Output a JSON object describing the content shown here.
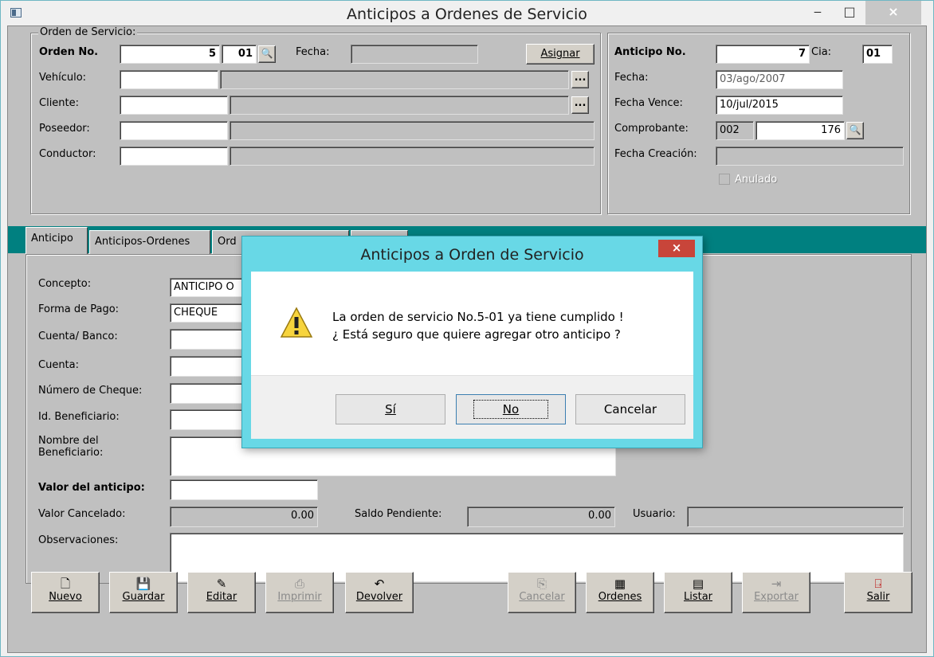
{
  "window": {
    "title": "Anticipos a Ordenes de Servicio",
    "min_glyph": "‒",
    "max_glyph": "□",
    "close_glyph": "×"
  },
  "orden": {
    "group_label": "Orden de Servicio:",
    "orden_label": "Orden No.",
    "orden_no": "5",
    "orden_cia": "01",
    "fecha_label": "Fecha:",
    "fecha": "",
    "asignar_label": "Asignar",
    "vehiculo_label": "Vehículo:",
    "cliente_label": "Cliente:",
    "poseedor_label": "Poseedor:",
    "conductor_label": "Conductor:",
    "dots": "..."
  },
  "anticipo": {
    "anticipo_label": "Anticipo No.",
    "anticipo_no": "7",
    "cia_label": "Cia:",
    "cia": "01",
    "fecha_label": "Fecha:",
    "fecha": "03/ago/2007",
    "fecha_vence_label": "Fecha Vence:",
    "fecha_vence": "10/jul/2015",
    "comprobante_label": "Comprobante:",
    "comprobante_tipo": "002",
    "comprobante_no": "176",
    "fecha_creacion_label": "Fecha Creación:",
    "anulado_label": "Anulado"
  },
  "tabs": [
    {
      "label": "Anticipo"
    },
    {
      "label": "Anticipos-Ordenes"
    },
    {
      "label": "Ord"
    }
  ],
  "form": {
    "concepto_label": "Concepto:",
    "concepto": "ANTICIPO O",
    "forma_pago_label": "Forma de Pago:",
    "forma_pago": "CHEQUE",
    "cuenta_banco_label": "Cuenta/ Banco:",
    "cuenta_label": "Cuenta:",
    "numero_cheque_label": "Número de Cheque:",
    "id_beneficiario_label": "Id. Beneficiario:",
    "nombre_beneficiario_label_1": "Nombre del",
    "nombre_beneficiario_label_2": "Beneficiario:",
    "valor_anticipo_label": "Valor del anticipo:",
    "valor_cancelado_label": "Valor Cancelado:",
    "valor_cancelado": "0.00",
    "saldo_pendiente_label": "Saldo Pendiente:",
    "saldo_pendiente": "0.00",
    "usuario_label": "Usuario:",
    "observaciones_label": "Observaciones:"
  },
  "toolbar": [
    {
      "label": "Nuevo",
      "icon": "page-icon",
      "enabled": true
    },
    {
      "label": "Guardar",
      "icon": "save-icon",
      "enabled": true
    },
    {
      "label": "Editar",
      "icon": "edit-icon",
      "enabled": true
    },
    {
      "label": "Imprimir",
      "icon": "print-icon",
      "enabled": false
    },
    {
      "label": "Devolver",
      "icon": "undo-icon",
      "enabled": true
    },
    {
      "label": "Cancelar",
      "icon": "cancel-icon",
      "enabled": false
    },
    {
      "label": "Ordenes",
      "icon": "grid-icon",
      "enabled": true
    },
    {
      "label": "Listar",
      "icon": "calendar-icon",
      "enabled": true
    },
    {
      "label": "Exportar",
      "icon": "export-icon",
      "enabled": false
    },
    {
      "label": "Salir",
      "icon": "exit-door-icon",
      "enabled": true
    }
  ],
  "dialog": {
    "title": "Anticipos a Orden de Servicio",
    "close_glyph": "×",
    "message_line1": "La orden de servicio No.5-01 ya tiene cumplido !",
    "message_line2": "¿ Está seguro que quiere agregar otro anticipo ?",
    "yes_label": "Sí",
    "no_label": "No",
    "cancel_label": "Cancelar"
  },
  "colors": {
    "tab_strip": "#008080",
    "dialog_frame": "#68d8e6",
    "dialog_close": "#c8453a"
  }
}
